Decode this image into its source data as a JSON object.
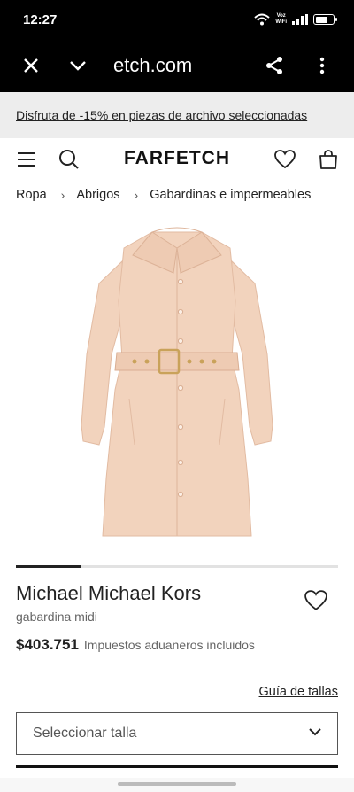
{
  "status_bar": {
    "time": "12:27",
    "voz": "Voz",
    "wifi": "WiFi",
    "battery_level": 0.7
  },
  "browser": {
    "url": "etch.com"
  },
  "promo": {
    "text": "Disfruta de -15% en piezas de archivo seleccionadas"
  },
  "header": {
    "logo": "FARFETCH"
  },
  "breadcrumb": [
    "Ropa",
    "Abrigos",
    "Gabardinas e impermeables"
  ],
  "breadcrumb_separator": "›",
  "gallery": {
    "progress": 0.2
  },
  "product": {
    "brand": "Michael Michael Kors",
    "name": "gabardina midi",
    "price": "$403.751",
    "tax_note": "Impuestos aduaneros incluidos"
  },
  "size": {
    "guide_label": "Guía de tallas",
    "select_label": "Seleccionar talla"
  },
  "colors": {
    "coat": "#f2d3bd",
    "coat_shade": "#e6bfa6",
    "buckle": "#c9a25a"
  }
}
